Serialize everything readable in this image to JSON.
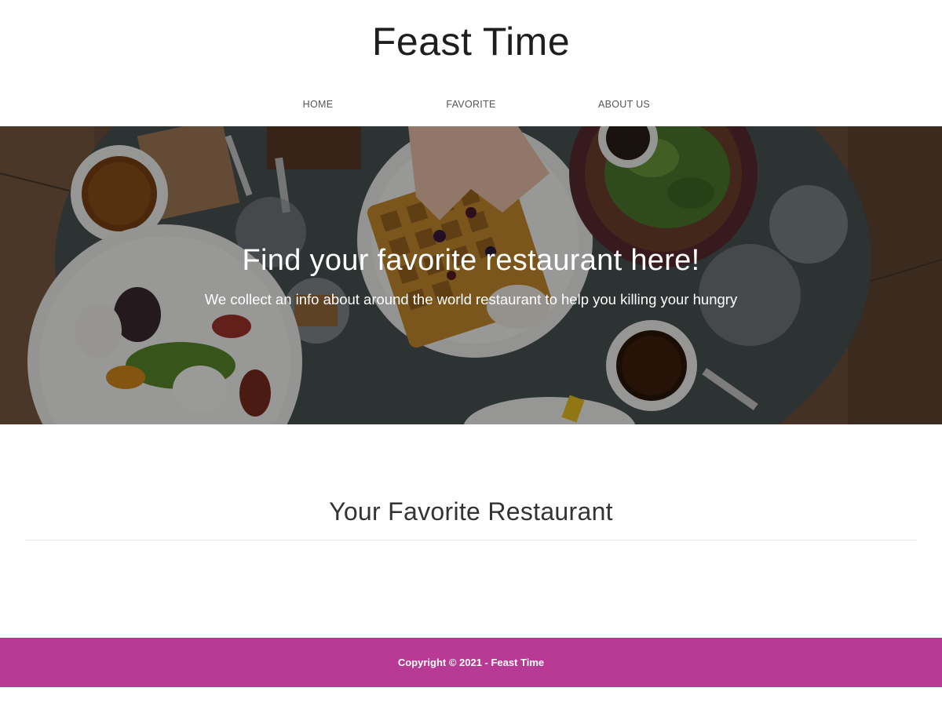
{
  "brand": {
    "title": "Feast Time"
  },
  "nav": {
    "home": "HOME",
    "favorite": "FAVORITE",
    "about": "ABOUT US"
  },
  "hero": {
    "title": "Find your favorite restaurant here!",
    "subtitle": "We collect an info about around the world restaurant to help you killing your hungry",
    "image": "restaurant-table-food-photo"
  },
  "favorites": {
    "title": "Your Favorite Restaurant"
  },
  "footer": {
    "copyright": "Copyright © 2021 - Feast Time"
  },
  "colors": {
    "footer": "#b93a95",
    "text": "#333333",
    "brand_text": "#1e1e1e"
  }
}
